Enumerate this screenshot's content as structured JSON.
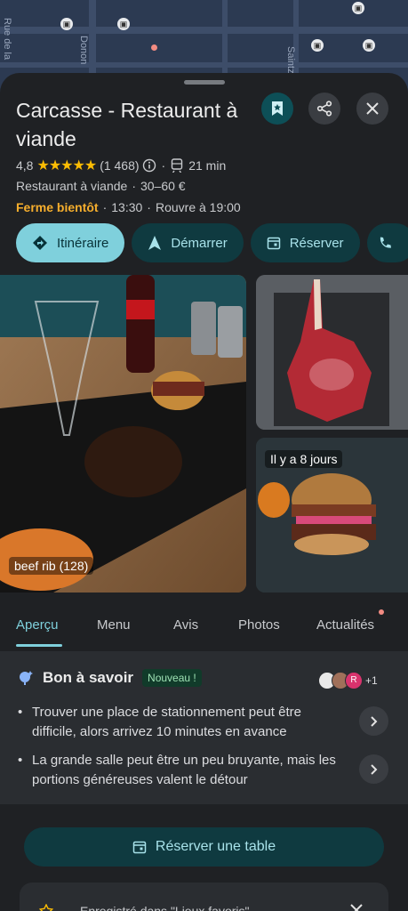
{
  "map": {
    "streets": [
      "Rue de la",
      "Donon",
      "Saintz"
    ]
  },
  "place": {
    "name": "Carcasse - Restaurant à viande",
    "rating": "4,8",
    "stars": "★★★★★",
    "review_count": "(1 468)",
    "travel_time": "21 min",
    "category": "Restaurant à viande",
    "price": "30–60 €",
    "status": "Ferme bientôt",
    "close_time": "13:30",
    "reopen": "Rouvre à 19:00"
  },
  "actions": {
    "directions": "Itinéraire",
    "start": "Démarrer",
    "reserve": "Réserver"
  },
  "photos": {
    "main_label": "beef rib (128)",
    "bottom_label": "Il y a 8 jours"
  },
  "tabs": [
    "Aperçu",
    "Menu",
    "Avis",
    "Photos",
    "Actualités"
  ],
  "good_to_know": {
    "title": "Bon à savoir",
    "badge": "Nouveau !",
    "avatar_initial": "R",
    "avatar_more": "+1",
    "tips": [
      "Trouver une place de stationnement peut être difficile, alors arrivez 10 minutes en avance",
      "La grande salle peut être un peu bruyante, mais les portions généreuses valent le détour"
    ]
  },
  "reserve_table": "Réserver une table",
  "saved_list": "Enregistré dans \"Lieux favoris\"",
  "colors": {
    "accent": "#7fd0dc",
    "star": "#fbbc04",
    "closing": "#f6ae2d"
  }
}
